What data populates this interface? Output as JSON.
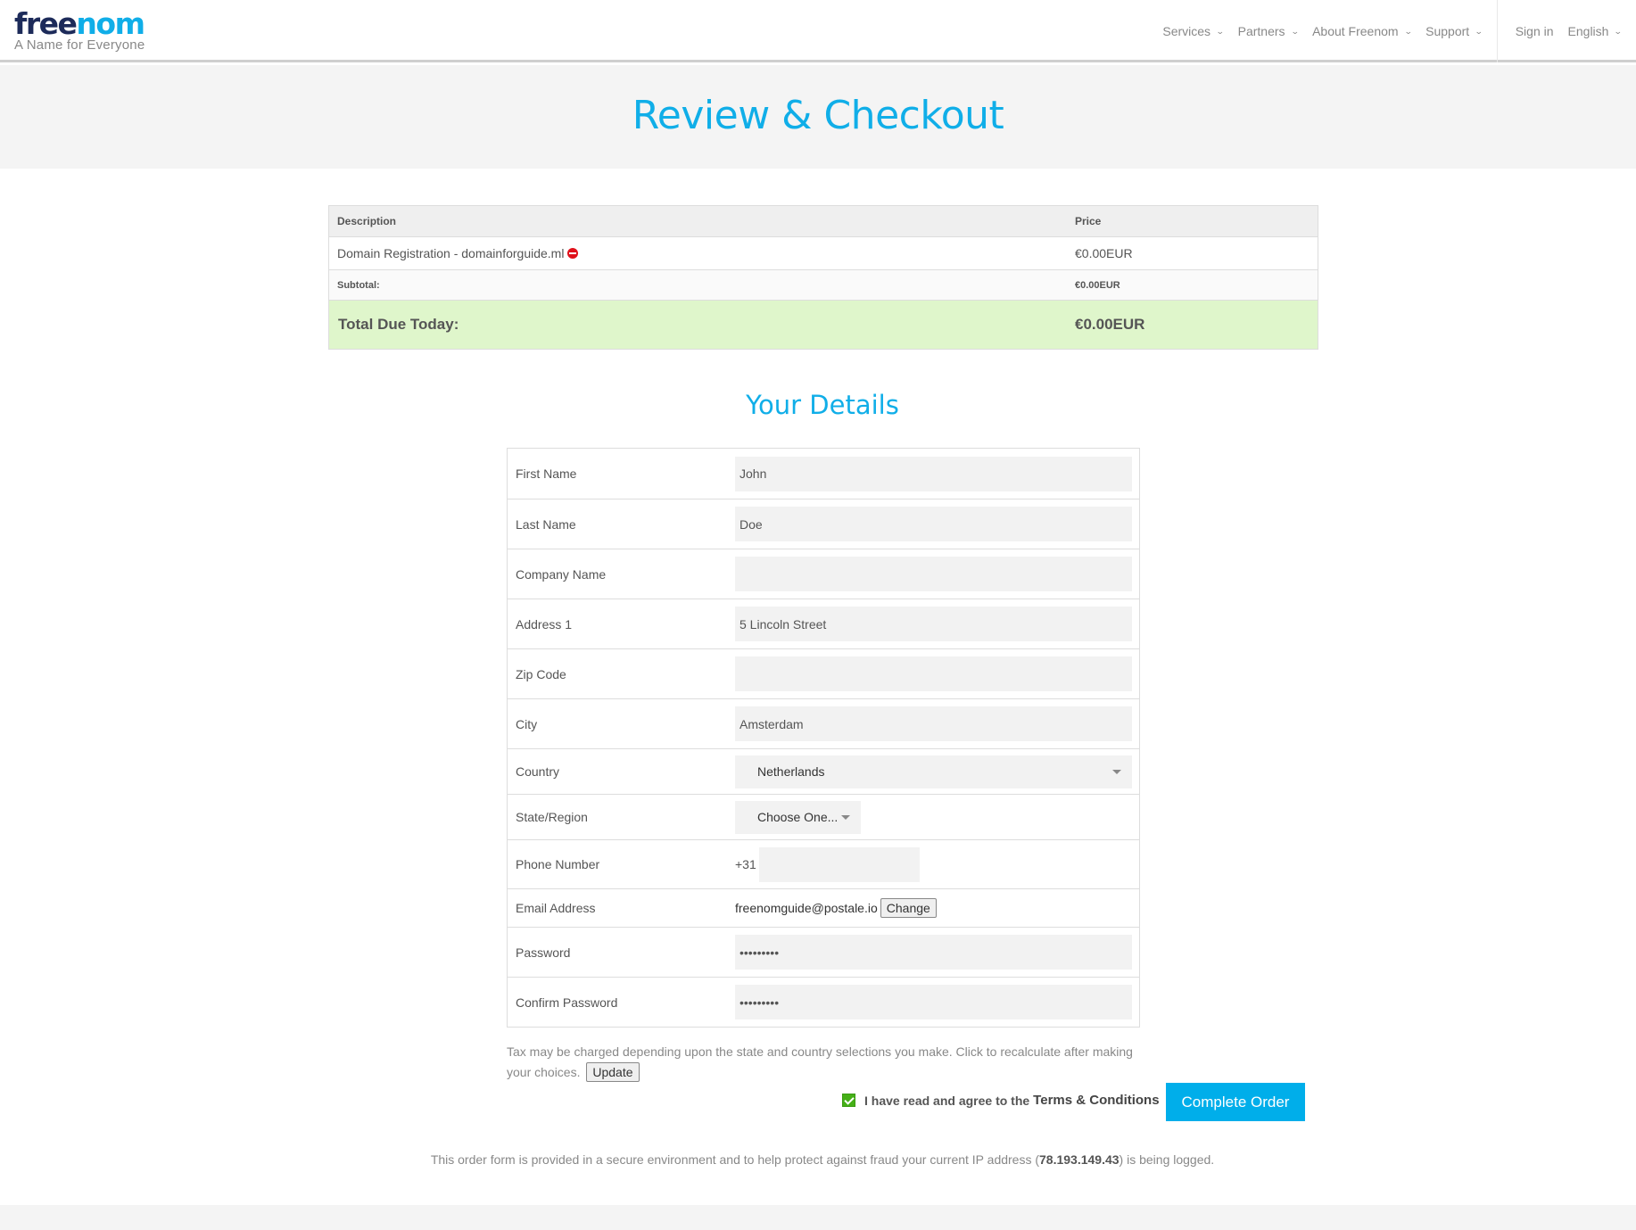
{
  "header": {
    "logo_part1": "free",
    "logo_part2": "nom",
    "tagline": "A Name for Everyone",
    "nav": [
      {
        "label": "Services"
      },
      {
        "label": "Partners"
      },
      {
        "label": "About Freenom"
      },
      {
        "label": "Support"
      }
    ],
    "sign_in": "Sign in",
    "language": "English"
  },
  "page_title": "Review & Checkout",
  "order": {
    "headers": {
      "description": "Description",
      "price": "Price"
    },
    "items": [
      {
        "description": "Domain Registration - domainforguide.ml",
        "price": "€0.00EUR"
      }
    ],
    "subtotal_label": "Subtotal:",
    "subtotal_value": "€0.00EUR",
    "total_label": "Total Due Today:",
    "total_value": "€0.00EUR"
  },
  "details": {
    "title": "Your Details",
    "first_name": {
      "label": "First Name",
      "value": "John"
    },
    "last_name": {
      "label": "Last Name",
      "value": "Doe"
    },
    "company": {
      "label": "Company Name",
      "value": ""
    },
    "address1": {
      "label": "Address 1",
      "value": "5 Lincoln Street"
    },
    "zip": {
      "label": "Zip Code",
      "value": ""
    },
    "city": {
      "label": "City",
      "value": "Amsterdam"
    },
    "country": {
      "label": "Country",
      "value": "Netherlands"
    },
    "state": {
      "label": "State/Region",
      "value": "Choose One..."
    },
    "phone": {
      "label": "Phone Number",
      "prefix": "+31",
      "value": ""
    },
    "email": {
      "label": "Email Address",
      "value": "freenomguide@postale.io",
      "change_label": "Change"
    },
    "password": {
      "label": "Password",
      "value": "•••••••••"
    },
    "confirm_password": {
      "label": "Confirm Password",
      "value": "•••••••••"
    }
  },
  "tax_note": "Tax may be charged depending upon the state and country selections you make. Click to recalculate after making your choices.",
  "update_label": "Update",
  "agree": {
    "checked": true,
    "text": "I have read and agree to the",
    "link": "Terms & Conditions"
  },
  "complete_order_label": "Complete Order",
  "secure_note": {
    "before": "This order form is provided in a secure environment and to help protect against fraud your current IP address (",
    "ip": "78.193.149.43",
    "after": ") is being logged."
  },
  "colors": {
    "accent": "#10aee8",
    "button": "#00aeea",
    "total_bg": "#dff6cb",
    "remove_red": "#e0101a",
    "checkbox_green": "#45b017"
  }
}
